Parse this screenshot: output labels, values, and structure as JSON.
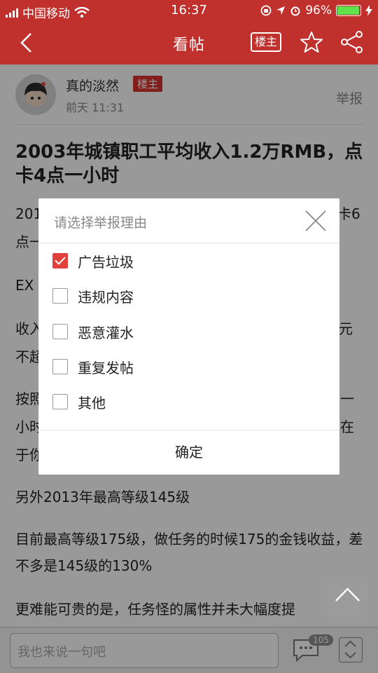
{
  "status_bar": {
    "carrier": "中国移动",
    "time": "16:37",
    "battery": "96%",
    "battery_level": 0.96
  },
  "nav": {
    "title": "看帖",
    "owner_filter_label": "楼主"
  },
  "post": {
    "author": "真的淡然",
    "author_badge": "楼主",
    "time": "前天 11:31",
    "report_label": "举报",
    "title": "2003年城镇职工平均收入1.2万RMB，点卡4点一小时",
    "paragraphs": [
      "201",
      "卡6",
      "点一",
      "EX",
      "收入",
      "元",
      "不超",
      "按照",
      "一",
      "小时",
      "在",
      "于你",
      "另外2013年最高等级145级",
      "目前最高等级175级，做任务的时候175的金钱收益，差不多是145级的130%",
      "更难能可贵的是，任务怪的属性并未大幅度提"
    ]
  },
  "dialog": {
    "title": "请选择举报理由",
    "options": [
      {
        "label": "广告垃圾",
        "checked": true
      },
      {
        "label": "违规内容",
        "checked": false
      },
      {
        "label": "恶意灌水",
        "checked": false
      },
      {
        "label": "重复发帖",
        "checked": false
      },
      {
        "label": "其他",
        "checked": false
      }
    ],
    "confirm_label": "确定"
  },
  "bottom_bar": {
    "comment_placeholder": "我也来说一句吧",
    "comment_count": "105"
  }
}
